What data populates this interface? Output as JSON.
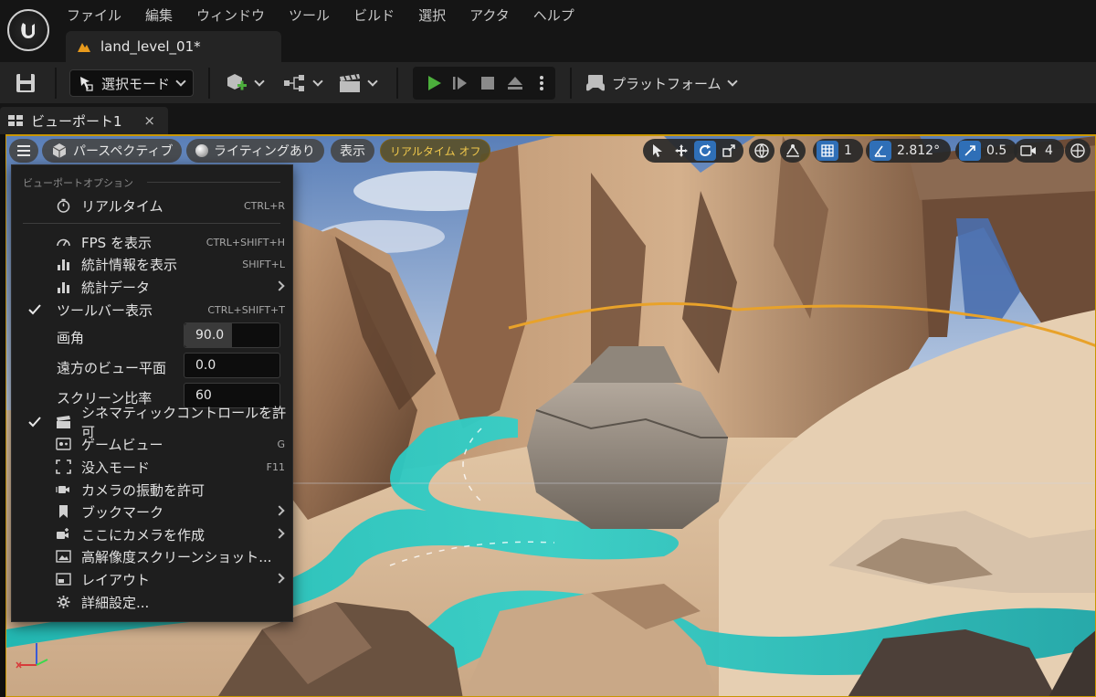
{
  "menubar": {
    "items": [
      "ファイル",
      "編集",
      "ウィンドウ",
      "ツール",
      "ビルド",
      "選択",
      "アクタ",
      "ヘルプ"
    ]
  },
  "level_tab": {
    "label": "land_level_01*"
  },
  "toolbar": {
    "mode_label": "選択モード",
    "platform_label": "プラットフォーム"
  },
  "viewport_tab": {
    "label": "ビューポート1",
    "close_glyph": "×"
  },
  "viewport_toolbar": {
    "perspective_label": "パースペクティブ",
    "lighting_label": "ライティングあり",
    "show_label": "表示",
    "realtime_label": "リアルタイム オフ",
    "grid_snap_value": "1",
    "rotation_snap_value": "2.812°",
    "scale_snap_value": "0.5",
    "camera_speed_value": "4"
  },
  "viewport_options_menu": {
    "header": "ビューポートオプション",
    "items": [
      {
        "label": "リアルタイム",
        "shortcut": "CTRL+R",
        "icon": "stopwatch-icon",
        "checked": false
      },
      {
        "label": "FPS を表示",
        "shortcut": "CTRL+SHIFT+H",
        "icon": "speedometer-icon",
        "checked": false
      },
      {
        "label": "統計情報を表示",
        "shortcut": "SHIFT+L",
        "icon": "bar-chart-icon",
        "checked": false
      },
      {
        "label": "統計データ",
        "icon": "bar-chart-icon",
        "submenu": true
      },
      {
        "label": "ツールバー表示",
        "shortcut": "CTRL+SHIFT+T",
        "checked": true
      },
      {
        "label": "シネマティックコントロールを許可",
        "icon": "clapperboard-icon",
        "checked": true
      },
      {
        "label": "ゲームビュー",
        "shortcut": "G",
        "icon": "gamepad-icon"
      },
      {
        "label": "没入モード",
        "shortcut": "F11",
        "icon": "fullscreen-icon"
      },
      {
        "label": "カメラの振動を許可",
        "icon": "camera-shake-icon"
      },
      {
        "label": "ブックマーク",
        "icon": "bookmark-icon",
        "submenu": true
      },
      {
        "label": "ここにカメラを作成",
        "icon": "camera-add-icon",
        "submenu": true
      },
      {
        "label": "高解像度スクリーンショット...",
        "icon": "screenshot-icon"
      },
      {
        "label": "レイアウト",
        "icon": "layout-icon",
        "submenu": true
      },
      {
        "label": "詳細設定...",
        "icon": "gear-icon"
      }
    ],
    "fields": [
      {
        "label": "画角",
        "value": "90.0",
        "fill_fraction": 0.5
      },
      {
        "label": "遠方のビュー平面",
        "value": "0.0"
      },
      {
        "label": "スクリーン比率",
        "value": "60"
      }
    ]
  },
  "colors": {
    "accent_blue": "#2f6fb7",
    "play_green": "#4caf3c",
    "viewport_border": "#c99600",
    "water_cyan": "#1fc6c0"
  }
}
